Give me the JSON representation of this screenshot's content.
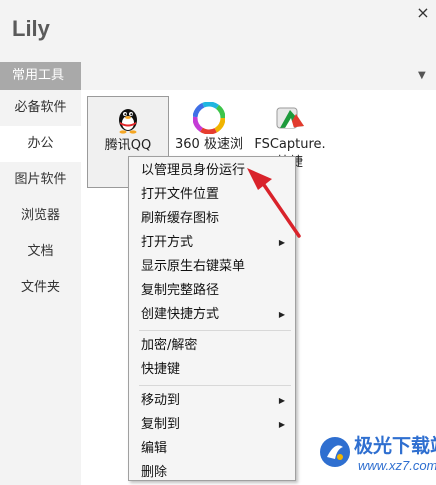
{
  "window": {
    "title": "Lily",
    "close_glyph": "×"
  },
  "group": {
    "current": "常用工具",
    "dropdown_glyph": "▼"
  },
  "sidebar": {
    "items": [
      {
        "label": "必备软件",
        "active": false
      },
      {
        "label": "办公",
        "active": true
      },
      {
        "label": "图片软件",
        "active": false
      },
      {
        "label": "浏览器",
        "active": false
      },
      {
        "label": "文档",
        "active": false
      },
      {
        "label": "文件夹",
        "active": false
      }
    ]
  },
  "apps": [
    {
      "label": "腾讯QQ",
      "icon": "qq-penguin-icon",
      "selected": true
    },
    {
      "label": "360 极速浏",
      "icon": "360-browser-icon",
      "selected": false
    },
    {
      "label": "FSCapture.快捷",
      "icon": "fscapture-icon",
      "selected": false
    }
  ],
  "context_menu": {
    "groups": [
      [
        {
          "label": "以管理员身份运行",
          "submenu": false
        },
        {
          "label": "打开文件位置",
          "submenu": false
        },
        {
          "label": "刷新缓存图标",
          "submenu": false
        },
        {
          "label": "打开方式",
          "submenu": true
        },
        {
          "label": "显示原生右键菜单",
          "submenu": false
        },
        {
          "label": "复制完整路径",
          "submenu": false
        },
        {
          "label": "创建快捷方式",
          "submenu": true
        }
      ],
      [
        {
          "label": "加密/解密",
          "submenu": false
        },
        {
          "label": "快捷键",
          "submenu": false
        }
      ],
      [
        {
          "label": "移动到",
          "submenu": true
        },
        {
          "label": "复制到",
          "submenu": true
        },
        {
          "label": "编辑",
          "submenu": false
        },
        {
          "label": "删除",
          "submenu": false
        }
      ]
    ],
    "submenu_glyph": "▶"
  },
  "watermark": {
    "name": "极光下载站",
    "url": "www.xz7.com"
  },
  "colors": {
    "accent_red": "#d9232b",
    "watermark_blue": "#2f6fd0",
    "group_header_bg": "#a9a9a9"
  }
}
